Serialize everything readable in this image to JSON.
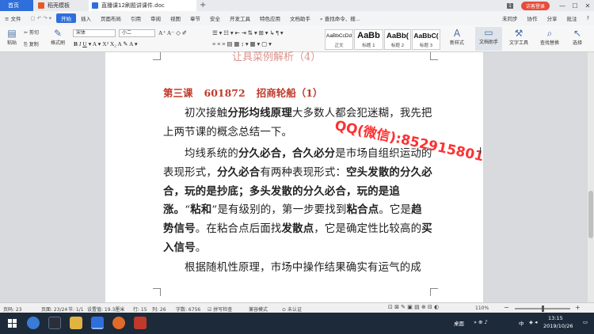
{
  "tabs": {
    "home": "首页",
    "doc1": "稻壳模板",
    "doc2": "直播课12刷题讲课件.doc",
    "add": "+",
    "badge": "1",
    "login": "访客登录",
    "min": "—",
    "max": "☐",
    "close": "✕"
  },
  "menu": {
    "file": "≡ 文件",
    "items": [
      "开始",
      "插入",
      "页面布局",
      "引用",
      "审阅",
      "视图",
      "章节",
      "安全",
      "开发工具",
      "特色应用",
      "文档助手"
    ],
    "search": "查找命令、搜...",
    "sync": "未同步",
    "collab": "协作",
    "share": "分享",
    "comment": "批注",
    "help": "?"
  },
  "ribbon": {
    "paste": "粘贴",
    "cut": "剪切",
    "copy": "复制",
    "format_painter": "格式刷",
    "font": "宋体",
    "size": "小二",
    "styles": [
      {
        "sample": "AaBbCcDd",
        "label": "正文"
      },
      {
        "sample": "AaBb",
        "label": "标题 1"
      },
      {
        "sample": "AaBb(",
        "label": "标题 2"
      },
      {
        "sample": "AaBbC(",
        "label": "标题 3"
      }
    ],
    "new_style": "新样式",
    "doc_assist": "文档助手",
    "text_tools": "文字工具",
    "find_replace": "查找替换",
    "select": "选择"
  },
  "document": {
    "cut_heading": "让具菜例解析（4）",
    "lesson_label": "第三课",
    "lesson_code": "601872",
    "lesson_name": "招商轮船（1）",
    "para1": "初次接触<b>分形均线原理</b>大多数人都会犯迷糊，我先把上两节课的概念总结一下。",
    "para2": "均线系统的<b>分久必合，合久必分</b>是市场自组织运动的表现形式，<b>分久必合</b>有两种表现形式：<b>空头发散的分久必合，玩的是抄底；多头发散的分久必合，玩的是追涨。</b>“<b>粘和</b>”是有级别的，第一步要找到<b>粘合点</b>。它是<b>趋势信号</b>。在粘合点后面找<b>发散点</b>，它是确定性比较高的<b>买入信号</b>。",
    "para3": "根据随机性原理，市场中操作结果确实有运气的成",
    "watermark": "QQ(微信):852915801"
  },
  "status": {
    "page": "页码: 23",
    "pages": "页面: 23/24",
    "section": "节: 1/1",
    "setting": "设置值: 19.3厘米",
    "row": "行: 15",
    "col": "列: 26",
    "words": "字数: 6756",
    "spell": "拼写检查",
    "compat": "兼容模式",
    "cert": "未认证",
    "zoom": "110%"
  },
  "taskbar": {
    "desktop": "桌面",
    "ime": "中",
    "time": "13:15",
    "date": "2019/10/26"
  }
}
